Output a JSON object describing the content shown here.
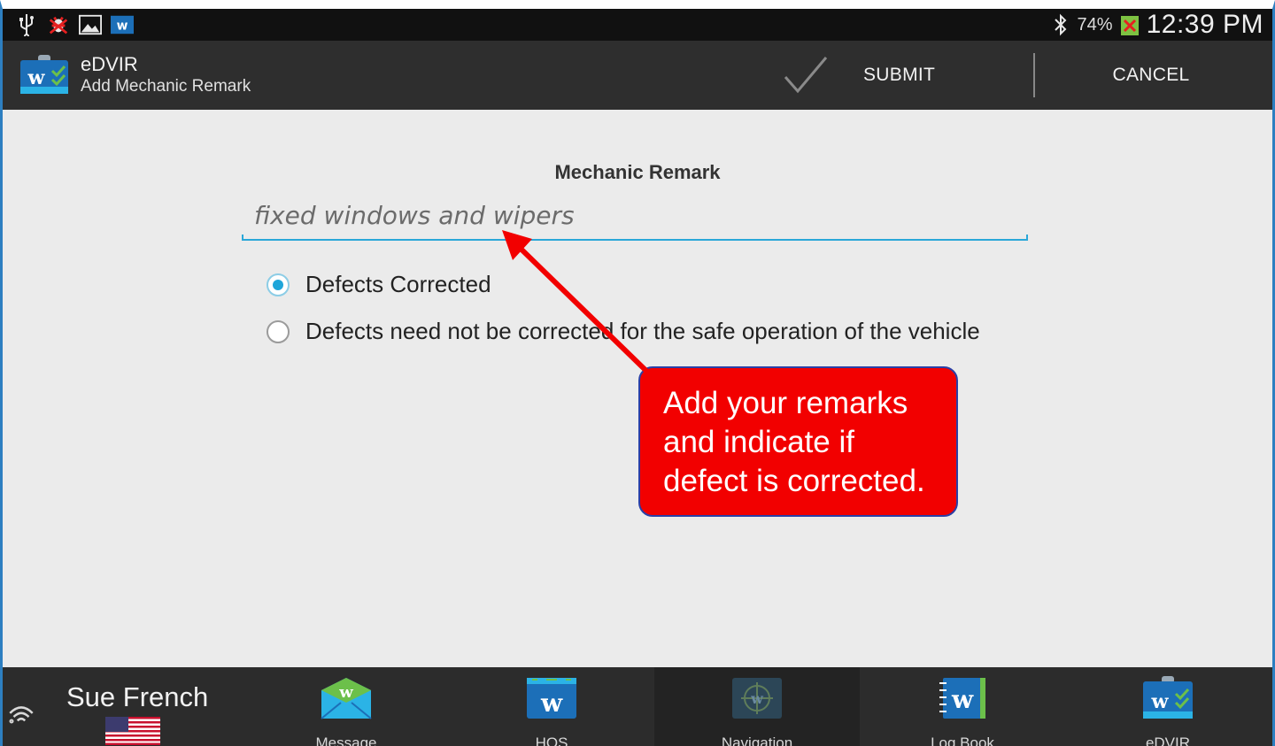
{
  "status_bar": {
    "battery_percent": "74%",
    "clock": "12:39 PM",
    "icons": [
      "usb-icon",
      "bug-icon",
      "image-icon",
      "app-w-icon",
      "bluetooth-icon",
      "battery-icon"
    ]
  },
  "action_bar": {
    "app_title": "eDVIR",
    "app_subtitle": "Add Mechanic Remark",
    "submit_label": "SUBMIT",
    "cancel_label": "CANCEL"
  },
  "form": {
    "remark_label": "Mechanic Remark",
    "remark_value": "fixed windows and wipers",
    "options": [
      {
        "label": "Defects Corrected",
        "checked": true
      },
      {
        "label": "Defects need not be corrected for the safe operation of the vehicle",
        "checked": false
      }
    ]
  },
  "callout": {
    "lines": [
      "Add your remarks",
      "and indicate if",
      "defect is corrected."
    ]
  },
  "bottom_nav": {
    "user_name": "Sue French",
    "items": [
      {
        "label": "Message",
        "icon": "message-icon"
      },
      {
        "label": "HOS",
        "icon": "hos-icon"
      },
      {
        "label": "Navigation",
        "icon": "navigation-icon"
      },
      {
        "label": "Log Book",
        "icon": "log-book-icon"
      },
      {
        "label": "eDVIR",
        "icon": "edvir-icon"
      }
    ]
  },
  "colors": {
    "accent": "#2aa7d8",
    "callout_fill": "#f20000",
    "callout_border": "#2b3fa6",
    "brand_blue": "#1c6fb8",
    "brand_green": "#6cc04a"
  }
}
